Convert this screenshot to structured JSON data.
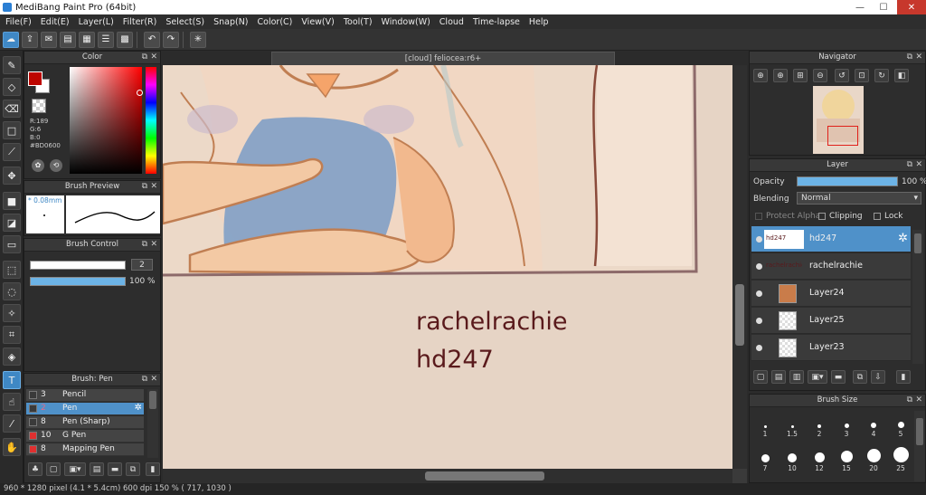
{
  "window": {
    "title": "MediBang Paint Pro (64bit)",
    "minimize": "—",
    "maximize": "☐",
    "close": "✕"
  },
  "menu": [
    "File(F)",
    "Edit(E)",
    "Layer(L)",
    "Filter(R)",
    "Select(S)",
    "Snap(N)",
    "Color(C)",
    "View(V)",
    "Tool(T)",
    "Window(W)",
    "Cloud",
    "Time-lapse",
    "Help"
  ],
  "panels": {
    "color": {
      "title": "Color",
      "r": "R:189",
      "g": "G:6",
      "b": "B:0",
      "hex": "#BD0600",
      "main_color": "#bd0600"
    },
    "brush_preview": {
      "title": "Brush Preview",
      "size": "* 0.08mm"
    },
    "brush_control": {
      "title": "Brush Control",
      "size_value": "2",
      "opacity_value": "100 %",
      "opacity_level": 1.0
    },
    "brush_list": {
      "title": "Brush: Pen",
      "items": [
        {
          "num": "3",
          "name": "Pencil",
          "color": "#3a3a3a"
        },
        {
          "num": "2",
          "name": "Pen",
          "color": "#3a3a3a"
        },
        {
          "num": "8",
          "name": "Pen (Sharp)",
          "color": "#3a3a3a"
        },
        {
          "num": "10",
          "name": "G Pen",
          "color": "#e03030"
        },
        {
          "num": "8",
          "name": "Mapping Pen",
          "color": "#e03030"
        }
      ]
    },
    "navigator": {
      "title": "Navigator"
    },
    "layer": {
      "title": "Layer",
      "opacity_label": "Opacity",
      "opacity_value": "100 %",
      "opacity_level": 1.0,
      "blending_label": "Blending",
      "blending_value": "Normal",
      "protect_alpha": "Protect Alpha",
      "clipping": "Clipping",
      "lock": "Lock",
      "layers": [
        {
          "name": "hd247",
          "thumb_text": "hd247"
        },
        {
          "name": "rachelrachie",
          "thumb_text": "rachelrachie"
        },
        {
          "name": "Layer24",
          "thumb_color": "#c97c4a"
        },
        {
          "name": "Layer25"
        },
        {
          "name": "Layer23"
        }
      ]
    },
    "brush_size": {
      "title": "Brush Size",
      "row1": [
        "1",
        "1.5",
        "2",
        "3",
        "4",
        "5"
      ],
      "row2": [
        "7",
        "10",
        "12",
        "15",
        "20",
        "25"
      ]
    }
  },
  "document": {
    "tab_title": "[cloud] feliocea:r6+",
    "text_line1": "rachelrachie",
    "text_line2": "hd247",
    "text_color": "#5a1a1c"
  },
  "status": "960 * 1280 pixel   (4.1 * 5.4cm)   600 dpi   150 %   ( 717, 1030 )"
}
